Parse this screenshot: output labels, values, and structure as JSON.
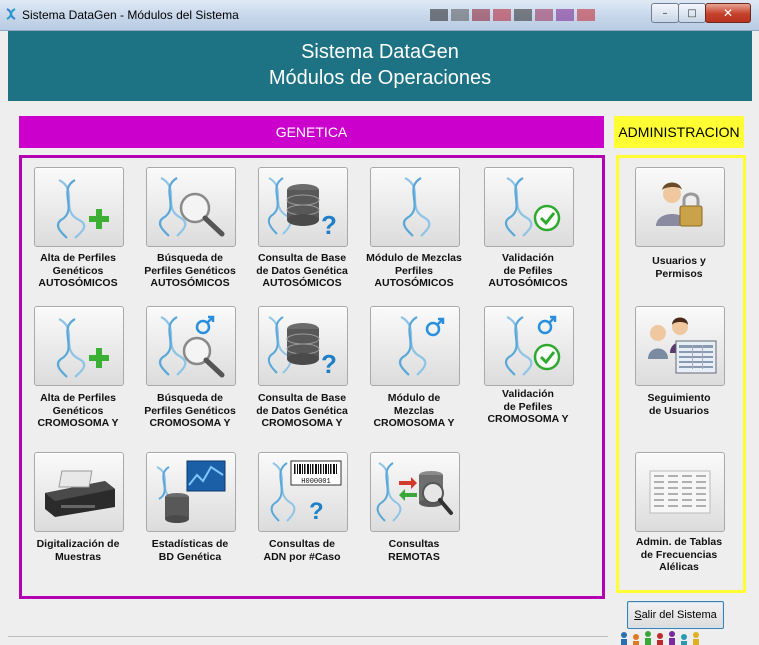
{
  "window": {
    "title": "Sistema DataGen - Módulos del Sistema",
    "minimize": "–",
    "maximize": "□",
    "close": "✕"
  },
  "header": {
    "line1": "Sistema DataGen",
    "line2": "Módulos de Operaciones",
    "color": "#1d7383"
  },
  "sections": {
    "genetica": {
      "label": "GENETICA",
      "color": "#cc00cc"
    },
    "admin": {
      "label": "ADMINISTRACION",
      "color": "#ffff33"
    }
  },
  "genetica_modules": [
    {
      "id": "alta-aut",
      "icon": "dna-plus-icon",
      "label": "Alta de Perfiles\nGenéticos\nAUTOSÓMICOS"
    },
    {
      "id": "busq-aut",
      "icon": "dna-search-icon",
      "label": "Búsqueda de\nPerfiles Genéticos\nAUTOSÓMICOS"
    },
    {
      "id": "cons-aut",
      "icon": "dna-database-icon",
      "label": "Consulta de Base\nde Datos Genética\nAUTOSÓMICOS"
    },
    {
      "id": "mezc-aut",
      "icon": "dna-mixture-icon",
      "label": "Módulo de Mezclas\nPerfiles\nAUTOSÓMICOS"
    },
    {
      "id": "vali-aut",
      "icon": "dna-check-icon",
      "label": "Validación\nde Pefiles\nAUTOSÓMICOS"
    },
    {
      "id": "alta-y",
      "icon": "dna-plus-icon",
      "label": "Alta de Perfiles\nGenéticos\nCROMOSOMA Y"
    },
    {
      "id": "busq-y",
      "icon": "dna-search-male-icon",
      "label": "Búsqueda de\nPerfiles Genéticos\nCROMOSOMA Y"
    },
    {
      "id": "cons-y",
      "icon": "dna-database-icon",
      "label": "Consulta de Base\nde Datos Genética\nCROMOSOMA Y"
    },
    {
      "id": "mezc-y",
      "icon": "dna-male-icon",
      "label": "Módulo de\nMezclas\nCROMOSOMA Y"
    },
    {
      "id": "vali-y",
      "icon": "dna-check-male-icon",
      "label": "Validación\nde Pefiles\nCROMOSOMA Y"
    },
    {
      "id": "digit",
      "icon": "scanner-icon",
      "label": "Digitalización de\nMuestras"
    },
    {
      "id": "estad",
      "icon": "stats-database-icon",
      "label": "Estadísticas de\nBD Genética"
    },
    {
      "id": "cons-adn",
      "icon": "barcode-dna-icon",
      "label": "Consultas de\nADN por #Caso",
      "barcode": "H000001"
    },
    {
      "id": "remotas",
      "icon": "remote-database-icon",
      "label": "Consultas\nREMOTAS"
    }
  ],
  "admin_modules": [
    {
      "id": "usuarios",
      "icon": "user-lock-icon",
      "label": "Usuarios y\nPermisos"
    },
    {
      "id": "seguim",
      "icon": "users-monitor-icon",
      "label": "Seguimiento\nde Usuarios"
    },
    {
      "id": "tablas",
      "icon": "frequency-table-icon",
      "label": "Admin. de Tablas\nde Frecuencias\nAlélicas"
    }
  ],
  "exit_button": {
    "accel": "S",
    "rest": "alir del Sistema"
  }
}
